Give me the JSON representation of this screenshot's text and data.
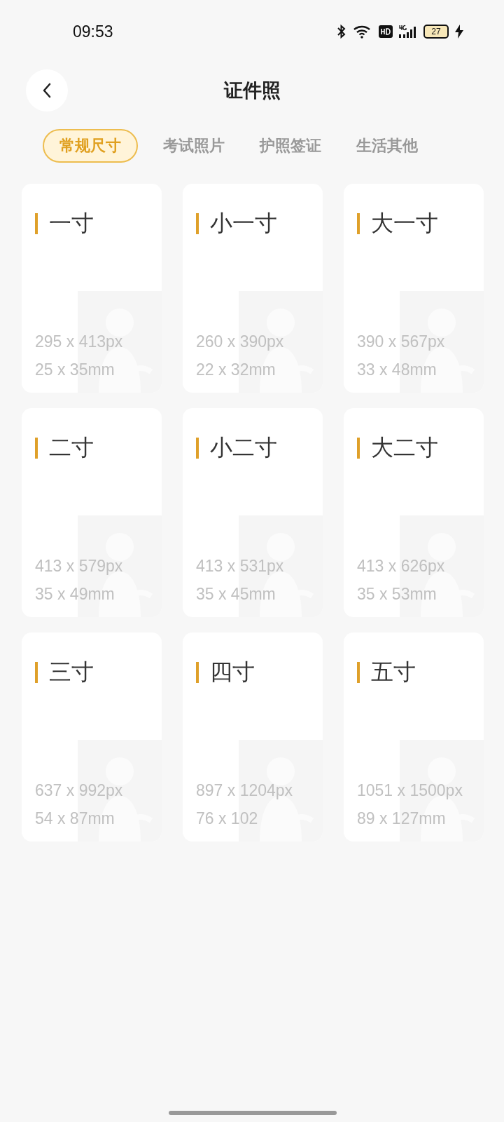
{
  "status_bar": {
    "time": "09:53",
    "battery": "27"
  },
  "header": {
    "title": "证件照"
  },
  "tabs": [
    {
      "label": "常规尺寸",
      "selected": true
    },
    {
      "label": "考试照片",
      "selected": false
    },
    {
      "label": "护照签证",
      "selected": false
    },
    {
      "label": "生活其他",
      "selected": false
    }
  ],
  "cards": [
    {
      "name": "一寸",
      "pixels": "295 x 413px",
      "size": "25 x 35mm"
    },
    {
      "name": "小一寸",
      "pixels": "260 x 390px",
      "size": "22 x 32mm"
    },
    {
      "name": "大一寸",
      "pixels": "390 x 567px",
      "size": "33 x 48mm"
    },
    {
      "name": "二寸",
      "pixels": "413 x 579px",
      "size": "35 x 49mm"
    },
    {
      "name": "小二寸",
      "pixels": "413 x 531px",
      "size": "35 x 45mm"
    },
    {
      "name": "大二寸",
      "pixels": "413 x 626px",
      "size": "35 x 53mm"
    },
    {
      "name": "三寸",
      "pixels": "637 x 992px",
      "size": "54 x 87mm"
    },
    {
      "name": "四寸",
      "pixels": "897 x 1204px",
      "size": "76 x 102"
    },
    {
      "name": "五寸",
      "pixels": "1051 x 1500px",
      "size": "89 x 127mm"
    }
  ]
}
